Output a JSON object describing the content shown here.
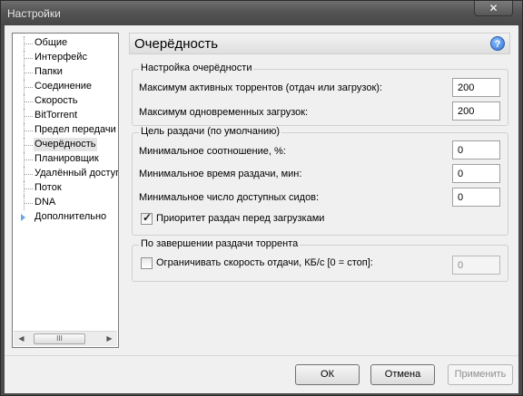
{
  "window": {
    "title": "Настройки",
    "close_glyph": "✕"
  },
  "tree": {
    "items": [
      {
        "label": "Общие",
        "selected": false,
        "expandable": false
      },
      {
        "label": "Интерфейс",
        "selected": false,
        "expandable": false
      },
      {
        "label": "Папки",
        "selected": false,
        "expandable": false
      },
      {
        "label": "Соединение",
        "selected": false,
        "expandable": false
      },
      {
        "label": "Скорость",
        "selected": false,
        "expandable": false
      },
      {
        "label": "BitTorrent",
        "selected": false,
        "expandable": false
      },
      {
        "label": "Предел передачи",
        "selected": false,
        "expandable": false
      },
      {
        "label": "Очерёдность",
        "selected": true,
        "expandable": false
      },
      {
        "label": "Планировщик",
        "selected": false,
        "expandable": false
      },
      {
        "label": "Удалённый доступ",
        "selected": false,
        "expandable": false
      },
      {
        "label": "Поток",
        "selected": false,
        "expandable": false
      },
      {
        "label": "DNA",
        "selected": false,
        "expandable": false
      },
      {
        "label": "Дополнительно",
        "selected": false,
        "expandable": true
      }
    ],
    "scroll_left": "◀",
    "scroll_right": "▶",
    "scroll_thumb": "III"
  },
  "panel": {
    "title": "Очерёдность",
    "help_glyph": "?",
    "queue": {
      "title": "Настройка очерёдности",
      "max_active_label": "Максимум активных торрентов (отдач или загрузок):",
      "max_active_value": "200",
      "max_downloads_label": "Максимум одновременных загрузок:",
      "max_downloads_value": "200"
    },
    "seeding": {
      "title": "Цель раздачи (по умолчанию)",
      "min_ratio_label": "Минимальное соотношение, %:",
      "min_ratio_value": "0",
      "min_time_label": "Минимальное время раздачи, мин:",
      "min_time_value": "0",
      "min_seeds_label": "Минимальное число доступных сидов:",
      "min_seeds_value": "0",
      "priority_label": "Приоритет раздач перед загрузками",
      "priority_checked": true
    },
    "after_seeding": {
      "title": "По завершении раздачи торрента",
      "limit_label": "Ограничивать скорость отдачи, КБ/с [0 = стоп]:",
      "limit_checked": false,
      "limit_value": "0"
    }
  },
  "buttons": {
    "ok": "ОК",
    "cancel": "Отмена",
    "apply": "Применить"
  }
}
